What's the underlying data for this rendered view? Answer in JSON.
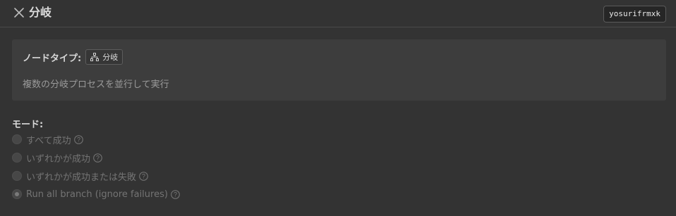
{
  "header": {
    "title": "分岐",
    "node_id": "yosurifrmxk"
  },
  "info": {
    "type_label": "ノードタイプ:",
    "type_value": "分岐",
    "description": "複数の分岐プロセスを並行して実行"
  },
  "mode": {
    "label": "モード:",
    "options": [
      {
        "label": "すべて成功",
        "checked": false,
        "disabled": true
      },
      {
        "label": "いずれかが成功",
        "checked": false,
        "disabled": true
      },
      {
        "label": "いずれかが成功または失敗",
        "checked": false,
        "disabled": true
      },
      {
        "label": "Run all branch (ignore failures)",
        "checked": true,
        "disabled": true
      }
    ]
  },
  "colors": {
    "background": "#333333",
    "info_box": "#3d3d3d",
    "text_primary": "#d8d8d8",
    "text_muted": "#9a9a9a",
    "text_disabled": "#747474"
  },
  "icons": {
    "close": "close-icon",
    "branch": "branch-icon",
    "help": "help-icon"
  }
}
